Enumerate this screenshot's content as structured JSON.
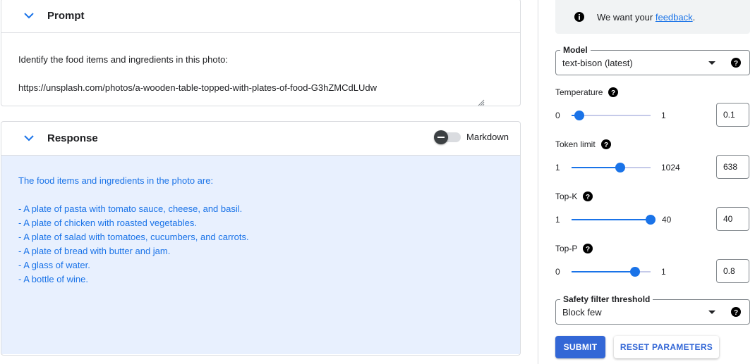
{
  "prompt": {
    "title": "Prompt",
    "lines": [
      "Identify the food items and ingredients in this photo:",
      "https://unsplash.com/photos/a-wooden-table-topped-with-plates-of-food-G3hZMCdLUdw"
    ]
  },
  "response": {
    "title": "Response",
    "markdown_label": "Markdown",
    "markdown_enabled": false,
    "intro": "The food items and ingredients in the photo are:",
    "items": [
      "- A plate of pasta with tomato sauce, cheese, and basil.",
      "- A plate of chicken with roasted vegetables.",
      "- A plate of salad with tomatoes, cucumbers, and carrots.",
      "- A plate of bread with butter and jam.",
      "- A glass of water.",
      "- A bottle of wine."
    ]
  },
  "feedback": {
    "prefix": "We want your ",
    "link": "feedback",
    "suffix": "."
  },
  "model": {
    "legend": "Model",
    "value": "text-bison (latest)"
  },
  "params": {
    "temperature": {
      "label": "Temperature",
      "min": "0",
      "max": "1",
      "value": "0.1",
      "fraction": 0.1
    },
    "token_limit": {
      "label": "Token limit",
      "min": "1",
      "max": "1024",
      "value": "638",
      "fraction": 0.62
    },
    "top_k": {
      "label": "Top-K",
      "min": "1",
      "max": "40",
      "value": "40",
      "fraction": 1.0
    },
    "top_p": {
      "label": "Top-P",
      "min": "0",
      "max": "1",
      "value": "0.8",
      "fraction": 0.8
    }
  },
  "safety": {
    "legend": "Safety filter threshold",
    "value": "Block few"
  },
  "buttons": {
    "submit": "SUBMIT",
    "reset": "RESET PARAMETERS"
  },
  "colors": {
    "accent": "#1a73e8",
    "submit_bg": "#3367d6",
    "response_bg": "#e8f0fe"
  },
  "icons": {
    "collapse": "chevron-down-icon",
    "info": "info-icon",
    "help": "help-circle-icon",
    "dropdown": "caret-down-icon"
  }
}
